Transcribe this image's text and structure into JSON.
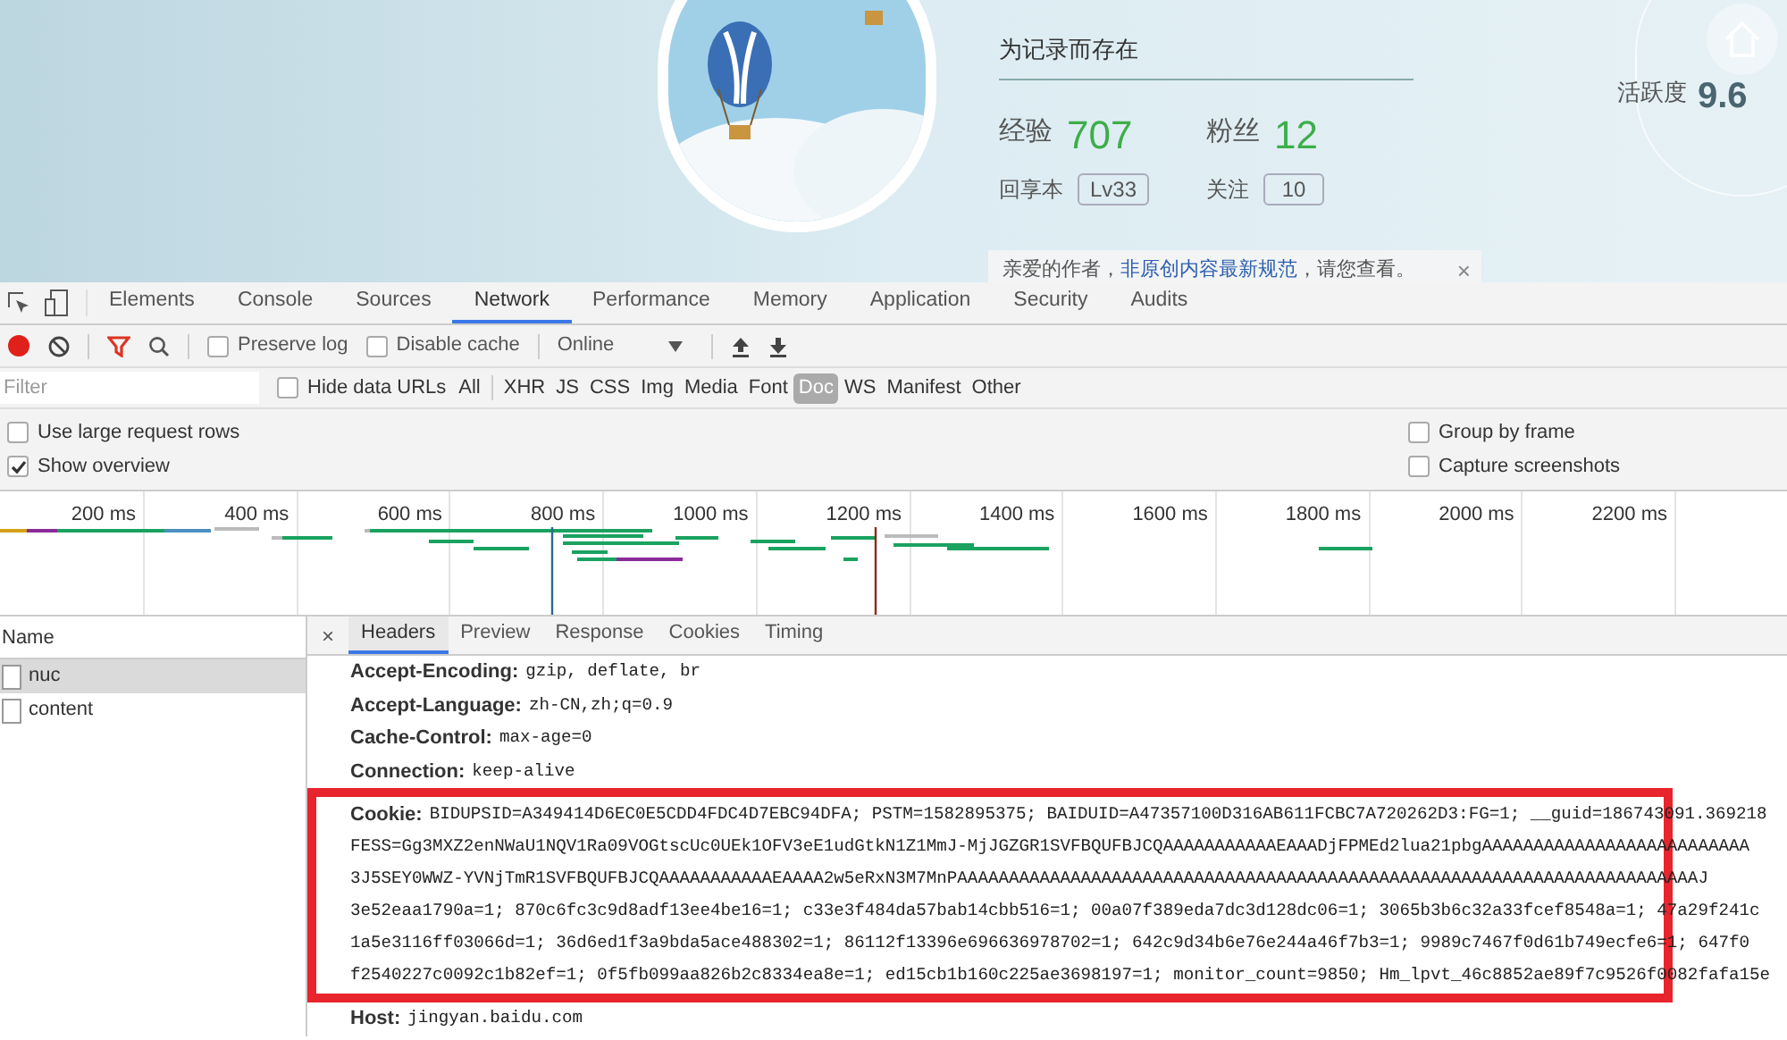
{
  "profile": {
    "motto": "为记录而存在",
    "stats": [
      {
        "label": "经验",
        "value": "707"
      },
      {
        "label": "粉丝",
        "value": "12"
      }
    ],
    "sub": [
      {
        "label": "回享本",
        "value": "Lv33"
      },
      {
        "label": "关注",
        "value": "10"
      }
    ],
    "activity": {
      "label": "活跃度",
      "value": "9.6"
    },
    "notice": {
      "text": "亲爱的作者，",
      "link": "非原创内容最新规范",
      "after": "，请您查看。",
      "close": "×"
    }
  },
  "devtools": {
    "tabs": [
      {
        "label": "Elements",
        "selected": false
      },
      {
        "label": "Console",
        "selected": false
      },
      {
        "label": "Sources",
        "selected": false
      },
      {
        "label": "Network",
        "selected": true
      },
      {
        "label": "Performance",
        "selected": false
      },
      {
        "label": "Memory",
        "selected": false
      },
      {
        "label": "Application",
        "selected": false
      },
      {
        "label": "Security",
        "selected": false
      },
      {
        "label": "Audits",
        "selected": false
      }
    ],
    "toolbar": {
      "checks": [
        {
          "label": "Preserve log",
          "checked": false
        },
        {
          "label": "Disable cache",
          "checked": false
        }
      ],
      "throttle": "Online"
    },
    "filter": {
      "placeholder": "Filter"
    },
    "hide_data_urls": {
      "label": "Hide data URLs",
      "checked": false
    },
    "types": [
      {
        "label": "All",
        "selected": false
      },
      {
        "label": "XHR",
        "selected": false
      },
      {
        "label": "JS",
        "selected": false
      },
      {
        "label": "CSS",
        "selected": false
      },
      {
        "label": "Img",
        "selected": false
      },
      {
        "label": "Media",
        "selected": false
      },
      {
        "label": "Font",
        "selected": false
      },
      {
        "label": "Doc",
        "selected": true
      },
      {
        "label": "WS",
        "selected": false
      },
      {
        "label": "Manifest",
        "selected": false
      },
      {
        "label": "Other",
        "selected": false
      }
    ],
    "options_left": [
      {
        "label": "Use large request rows",
        "checked": false
      },
      {
        "label": "Show overview",
        "checked": true
      }
    ],
    "options_right": [
      {
        "label": "Group by frame",
        "checked": false
      },
      {
        "label": "Capture screenshots",
        "checked": false
      }
    ],
    "timeline": {
      "ticks": [
        "200 ms",
        "400 ms",
        "600 ms",
        "800 ms",
        "1000 ms",
        "1200 ms",
        "1400 ms",
        "1600 ms",
        "1800 ms",
        "2000 ms",
        "2200 ms"
      ]
    },
    "requests": {
      "header": "Name",
      "rows": [
        {
          "name": "nuc",
          "selected": true
        },
        {
          "name": "content",
          "selected": false
        }
      ]
    },
    "detail_close": "×",
    "detail_tabs": [
      {
        "label": "Headers",
        "selected": true
      },
      {
        "label": "Preview",
        "selected": false
      },
      {
        "label": "Response",
        "selected": false
      },
      {
        "label": "Cookies",
        "selected": false
      },
      {
        "label": "Timing",
        "selected": false
      }
    ],
    "headers": [
      {
        "name": "Accept-Encoding:",
        "value": "gzip, deflate, br"
      },
      {
        "name": "Accept-Language:",
        "value": "zh-CN,zh;q=0.9"
      },
      {
        "name": "Cache-Control:",
        "value": "max-age=0"
      },
      {
        "name": "Connection:",
        "value": "keep-alive"
      }
    ],
    "cookie": {
      "name": "Cookie:",
      "lines": [
        "BIDUPSID=A349414D6EC0E5CDD4FDC4D7EBC94DFA; PSTM=1582895375; BAIDUID=A47357100D316AB611FCBC7A720262D3:FG=1; __guid=186743091.369218",
        "FESS=Gg3MXZ2enNWaU1NQV1Ra09VOGtscUc0UEk1OFV3eE1udGtkN1Z1MmJ-MjJGZGR1SVFBQUFBJCQAAAAAAAAAAAEAAADjFPMEd2lua21pbgAAAAAAAAAAAAAAAAAAAAAAAAAA",
        "3J5SEY0WWZ-YVNjTmR1SVFBQUFBJCQAAAAAAAAAAAEAAAA2w5eRxN3M7MnPAAAAAAAAAAAAAAAAAAAAAAAAAAAAAAAAAAAAAAAAAAAAAAAAAAAAAAAAAAAAAAAAAAAAAAAAJ",
        "3e52eaa1790a=1; 870c6fc3c9d8adf13ee4be16=1; c33e3f484da57bab14cbb516=1; 00a07f389eda7dc3d128dc06=1; 3065b3b6c32a33fcef8548a=1; 47a29f241c",
        "1a5e3116ff03066d=1; 36d6ed1f3a9bda5ace488302=1; 86112f13396e696636978702=1; 642c9d34b6e76e244a46f7b3=1; 9989c7467f0d61b749ecfe6=1; 647f0",
        "f2540227c0092c1b82ef=1; 0f5fb099aa826b2c8334ea8e=1; ed15cb1b160c225ae3698197=1; monitor_count=9850; Hm_lpvt_46c8852ae89f7c9526f0082fafa15e"
      ]
    },
    "host": {
      "name": "Host:",
      "value": "jingyan.baidu.com"
    }
  }
}
